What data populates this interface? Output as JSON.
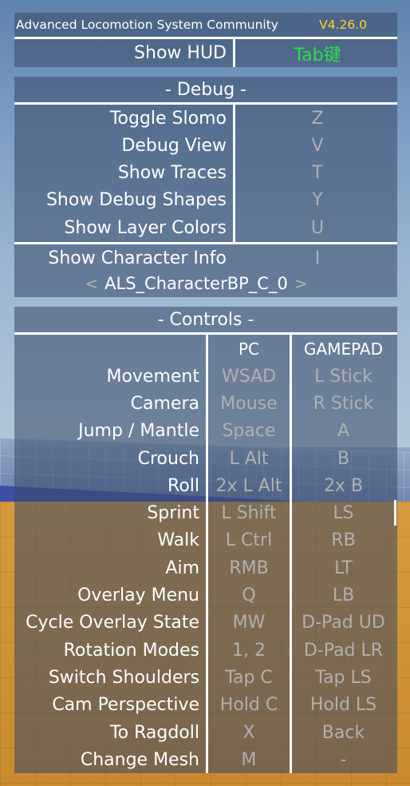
{
  "header": {
    "title": "Advanced Locomotion System Community",
    "version": "V4.26.0"
  },
  "hud": {
    "label": "Show HUD",
    "key": "Tab键"
  },
  "debug": {
    "title": "- Debug -",
    "items": [
      {
        "label": "Toggle Slomo",
        "key": "Z"
      },
      {
        "label": "Debug View",
        "key": "V"
      },
      {
        "label": "Show Traces",
        "key": "T"
      },
      {
        "label": "Show Debug Shapes",
        "key": "Y"
      },
      {
        "label": "Show Layer Colors",
        "key": "U"
      }
    ],
    "character_info": {
      "label": "Show Character Info",
      "key": "I"
    },
    "character_selector": {
      "prev": "<",
      "name": "ALS_CharacterBP_C_0",
      "next": ">"
    }
  },
  "controls": {
    "title": "- Controls -",
    "col_pc": "PC",
    "col_gamepad": "GAMEPAD",
    "rows": [
      {
        "action": "Movement",
        "pc": "WSAD",
        "gamepad": "L Stick"
      },
      {
        "action": "Camera",
        "pc": "Mouse",
        "gamepad": "R Stick"
      },
      {
        "action": "Jump / Mantle",
        "pc": "Space",
        "gamepad": "A"
      },
      {
        "action": "Crouch",
        "pc": "L Alt",
        "gamepad": "B"
      },
      {
        "action": "Roll",
        "pc": "2x L Alt",
        "gamepad": "2x B"
      },
      {
        "action": "Sprint",
        "pc": "L Shift",
        "gamepad": "LS"
      },
      {
        "action": "Walk",
        "pc": "L Ctrl",
        "gamepad": "RB"
      },
      {
        "action": "Aim",
        "pc": "RMB",
        "gamepad": "LT"
      },
      {
        "action": "Overlay Menu",
        "pc": "Q",
        "gamepad": "LB"
      },
      {
        "action": "Cycle Overlay State",
        "pc": "MW",
        "gamepad": "D-Pad UD"
      },
      {
        "action": "Rotation Modes",
        "pc": "1, 2",
        "gamepad": "D-Pad LR"
      },
      {
        "action": "Switch Shoulders",
        "pc": "Tap C",
        "gamepad": "Tap LS"
      },
      {
        "action": "Cam Perspective",
        "pc": "Hold C",
        "gamepad": "Hold LS"
      },
      {
        "action": "To Ragdoll",
        "pc": "X",
        "gamepad": "Back"
      },
      {
        "action": "Change Mesh",
        "pc": "M",
        "gamepad": "-"
      }
    ]
  },
  "colors": {
    "version": "#ffd21a",
    "hud_key": "#25e04a",
    "inactive_key": "#b0b0b0",
    "panel": "#384868"
  }
}
